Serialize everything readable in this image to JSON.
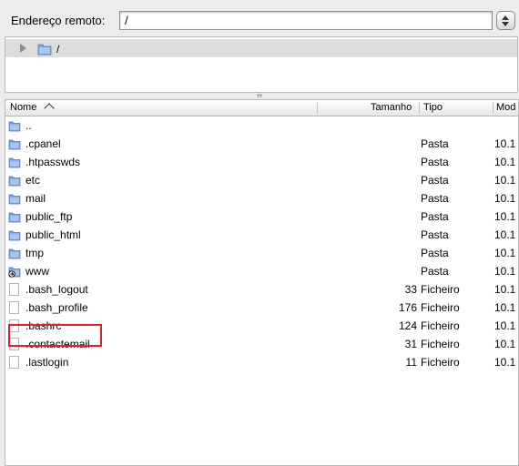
{
  "address_bar": {
    "label": "Endereço remoto:",
    "value": "/"
  },
  "tree": {
    "items": [
      {
        "label": "/",
        "icon": "folder-icon",
        "expanded": false
      }
    ]
  },
  "file_list": {
    "columns": {
      "name": "Nome",
      "size": "Tamanho",
      "type": "Tipo",
      "modified": "Mod"
    },
    "sort": {
      "column": "name",
      "direction": "ascending"
    },
    "rows": [
      {
        "name": "..",
        "size": "",
        "type": "",
        "modified": "",
        "icon": "folder-icon"
      },
      {
        "name": ".cpanel",
        "size": "",
        "type": "Pasta",
        "modified": "10.1",
        "icon": "folder-icon"
      },
      {
        "name": ".htpasswds",
        "size": "",
        "type": "Pasta",
        "modified": "10.1",
        "icon": "folder-icon"
      },
      {
        "name": "etc",
        "size": "",
        "type": "Pasta",
        "modified": "10.1",
        "icon": "folder-icon"
      },
      {
        "name": "mail",
        "size": "",
        "type": "Pasta",
        "modified": "10.1",
        "icon": "folder-icon"
      },
      {
        "name": "public_ftp",
        "size": "",
        "type": "Pasta",
        "modified": "10.1",
        "icon": "folder-icon"
      },
      {
        "name": "public_html",
        "size": "",
        "type": "Pasta",
        "modified": "10.1",
        "icon": "folder-icon",
        "highlighted": true
      },
      {
        "name": "tmp",
        "size": "",
        "type": "Pasta",
        "modified": "10.1",
        "icon": "folder-icon"
      },
      {
        "name": "www",
        "size": "",
        "type": "Pasta",
        "modified": "10.1",
        "icon": "symlink-folder-icon"
      },
      {
        "name": ".bash_logout",
        "size": "33",
        "type": "Ficheiro",
        "modified": "10.1",
        "icon": "file-icon"
      },
      {
        "name": ".bash_profile",
        "size": "176",
        "type": "Ficheiro",
        "modified": "10.1",
        "icon": "file-icon"
      },
      {
        "name": ".bashrc",
        "size": "124",
        "type": "Ficheiro",
        "modified": "10.1",
        "icon": "file-icon"
      },
      {
        "name": ".contactemail",
        "size": "31",
        "type": "Ficheiro",
        "modified": "10.1",
        "icon": "file-icon"
      },
      {
        "name": ".lastlogin",
        "size": "11",
        "type": "Ficheiro",
        "modified": "10.1",
        "icon": "file-icon"
      }
    ]
  },
  "colors": {
    "highlight": "#e4202a",
    "folder": "#5b8fd6",
    "selected_tree_row": "#dcdcdc"
  }
}
